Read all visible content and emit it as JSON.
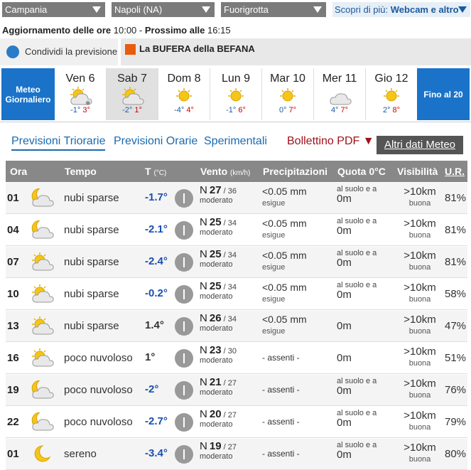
{
  "topbar": {
    "region": "Campania",
    "province": "Napoli (NA)",
    "locality": "Fuorigrotta",
    "scopri_prefix": "Scopri di più: ",
    "scopri_link": "Webcam e altro"
  },
  "update": {
    "label": "Aggiornamento delle ore ",
    "time": "10:00",
    "sep": " - ",
    "next_label": "Prossimo alle ",
    "next_time": "16:15"
  },
  "share": {
    "label": "Condividi la previsione"
  },
  "banner": {
    "label": "La BUFERA della BEFANA"
  },
  "days_nav": {
    "left": "Meteo Giornaliero",
    "right": "Fino al 20"
  },
  "days": [
    {
      "name": "Ven 6",
      "min": "-1°",
      "max": "3°",
      "icon": "cloud-snow-sun-icon"
    },
    {
      "name": "Sab 7",
      "min": "-2°",
      "max": "1°",
      "icon": "sun-cloud-icon"
    },
    {
      "name": "Dom 8",
      "min": "-4°",
      "max": "4°",
      "icon": "sun-icon"
    },
    {
      "name": "Lun 9",
      "min": "-1°",
      "max": "6°",
      "icon": "sun-icon"
    },
    {
      "name": "Mar 10",
      "min": "0°",
      "max": "7°",
      "icon": "sun-icon"
    },
    {
      "name": "Mer 11",
      "min": "4°",
      "max": "7°",
      "icon": "cloud-icon"
    },
    {
      "name": "Gio 12",
      "min": "2°",
      "max": "8°",
      "icon": "sun-icon"
    }
  ],
  "tabs": {
    "triorarie": "Previsioni Triorarie",
    "orarie": "Previsioni Orarie",
    "sperimentali": "Sperimentali",
    "bollettino": "Bollettino PDF ▼",
    "altri": "Altri dati Meteo"
  },
  "table_head": {
    "ora": "Ora",
    "tempo": "Tempo",
    "t": "T",
    "t_unit": "(°C)",
    "vento": "Vento",
    "vento_unit": "(km/h)",
    "prec": "Precipitazioni",
    "quota": "Quota 0°C",
    "vis": "Visibilità",
    "ur": "U.R."
  },
  "rows": [
    {
      "ora": "01",
      "desc": "nubi sparse",
      "temp": "-1.7°",
      "dir": "N",
      "speed": "27",
      "gust": "/ 36",
      "wdesc": "moderato",
      "prec": "<0.05 mm",
      "pdesc": "esigue",
      "quota_pre": "al suolo e a",
      "quota": "0m",
      "vis": ">10km",
      "vdesc": "buona",
      "ur": "81%",
      "icon": "moon-cloud-icon"
    },
    {
      "ora": "04",
      "desc": "nubi sparse",
      "temp": "-2.1°",
      "dir": "N",
      "speed": "25",
      "gust": "/ 34",
      "wdesc": "moderato",
      "prec": "<0.05 mm",
      "pdesc": "esigue",
      "quota_pre": "al suolo e a",
      "quota": "0m",
      "vis": ">10km",
      "vdesc": "buona",
      "ur": "81%",
      "icon": "moon-cloud-icon"
    },
    {
      "ora": "07",
      "desc": "nubi sparse",
      "temp": "-2.4°",
      "dir": "N",
      "speed": "25",
      "gust": "/ 34",
      "wdesc": "moderato",
      "prec": "<0.05 mm",
      "pdesc": "esigue",
      "quota_pre": "al suolo e a",
      "quota": "0m",
      "vis": ">10km",
      "vdesc": "buona",
      "ur": "81%",
      "icon": "sun-cloud-icon"
    },
    {
      "ora": "10",
      "desc": "nubi sparse",
      "temp": "-0.2°",
      "dir": "N",
      "speed": "25",
      "gust": "/ 34",
      "wdesc": "moderato",
      "prec": "<0.05 mm",
      "pdesc": "esigue",
      "quota_pre": "al suolo e a",
      "quota": "0m",
      "vis": ">10km",
      "vdesc": "buona",
      "ur": "58%",
      "icon": "sun-cloud-icon"
    },
    {
      "ora": "13",
      "desc": "nubi sparse",
      "temp": "1.4°",
      "dir": "N",
      "speed": "26",
      "gust": "/ 34",
      "wdesc": "moderato",
      "prec": "<0.05 mm",
      "pdesc": "esigue",
      "quota_pre": "",
      "quota": "0m",
      "vis": ">10km",
      "vdesc": "buona",
      "ur": "47%",
      "icon": "sun-cloud-icon"
    },
    {
      "ora": "16",
      "desc": "poco nuvoloso",
      "temp": "1°",
      "dir": "N",
      "speed": "23",
      "gust": "/ 30",
      "wdesc": "moderato",
      "prec": "- assenti -",
      "pdesc": "",
      "quota_pre": "",
      "quota": "0m",
      "vis": ">10km",
      "vdesc": "buona",
      "ur": "51%",
      "icon": "sun-cloud-icon"
    },
    {
      "ora": "19",
      "desc": "poco nuvoloso",
      "temp": "-2°",
      "dir": "N",
      "speed": "21",
      "gust": "/ 27",
      "wdesc": "moderato",
      "prec": "- assenti -",
      "pdesc": "",
      "quota_pre": "al suolo e a",
      "quota": "0m",
      "vis": ">10km",
      "vdesc": "buona",
      "ur": "76%",
      "icon": "moon-cloud-icon"
    },
    {
      "ora": "22",
      "desc": "poco nuvoloso",
      "temp": "-2.7°",
      "dir": "N",
      "speed": "20",
      "gust": "/ 27",
      "wdesc": "moderato",
      "prec": "- assenti -",
      "pdesc": "",
      "quota_pre": "al suolo e a",
      "quota": "0m",
      "vis": ">10km",
      "vdesc": "buona",
      "ur": "79%",
      "icon": "moon-cloud-icon"
    },
    {
      "ora": "01",
      "desc": "sereno",
      "temp": "-3.4°",
      "dir": "N",
      "speed": "19",
      "gust": "/ 27",
      "wdesc": "moderato",
      "prec": "- assenti -",
      "pdesc": "",
      "quota_pre": "al suolo e a",
      "quota": "0m",
      "vis": ">10km",
      "vdesc": "buona",
      "ur": "80%",
      "icon": "moon-icon"
    }
  ],
  "colors": {
    "accent": "#1a73c9",
    "header": "#888888",
    "neg_temp": "#1a4fb0",
    "max_temp": "#cc0000"
  }
}
